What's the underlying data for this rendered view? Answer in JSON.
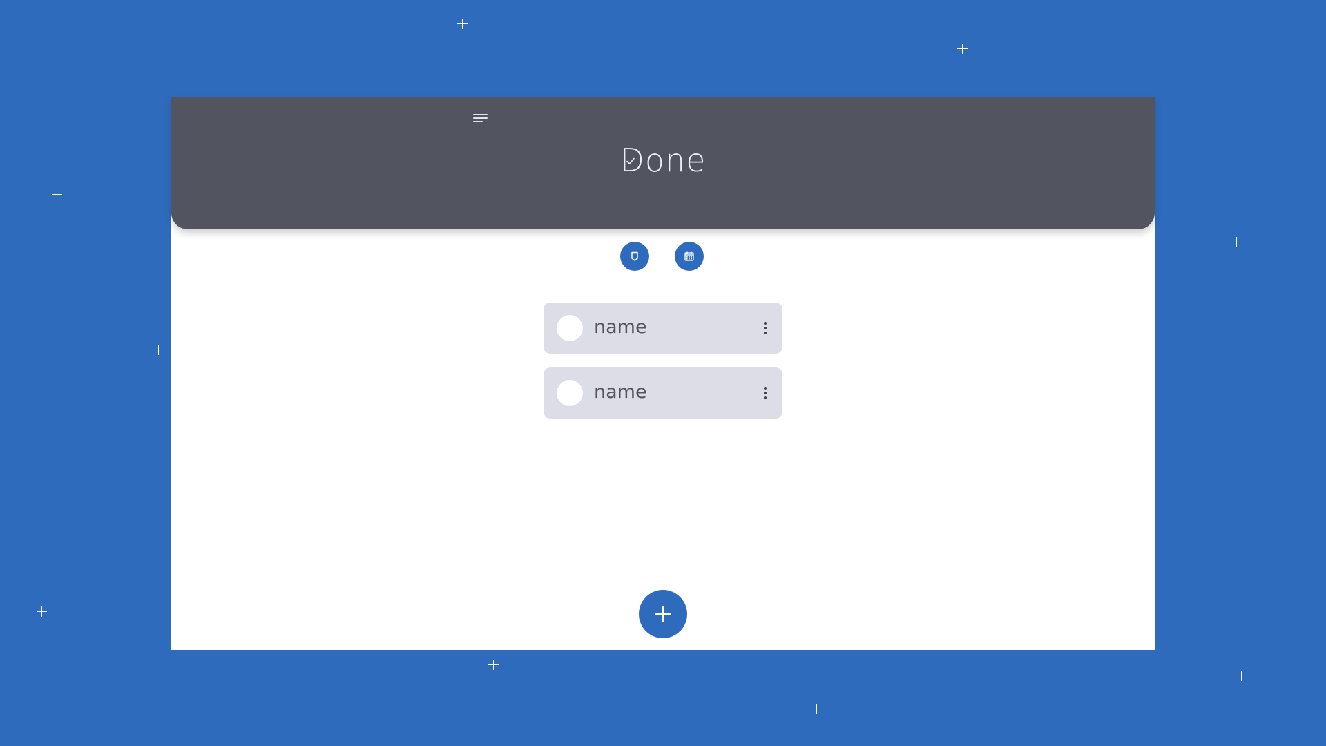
{
  "header": {
    "title": "Done",
    "menu_icon": "menu-lines-icon",
    "title_badge_icon": "check-icon"
  },
  "filters": [
    {
      "icon": "tag-icon"
    },
    {
      "icon": "calendar-icon"
    }
  ],
  "tasks": [
    {
      "name": "name"
    },
    {
      "name": "name"
    }
  ],
  "fab": {
    "icon": "plus-icon"
  },
  "colors": {
    "background": "#2f6bbd",
    "header": "#52555f",
    "accent": "#2f6bbd",
    "task_bg": "#dcdde6",
    "surface": "#ffffff"
  }
}
